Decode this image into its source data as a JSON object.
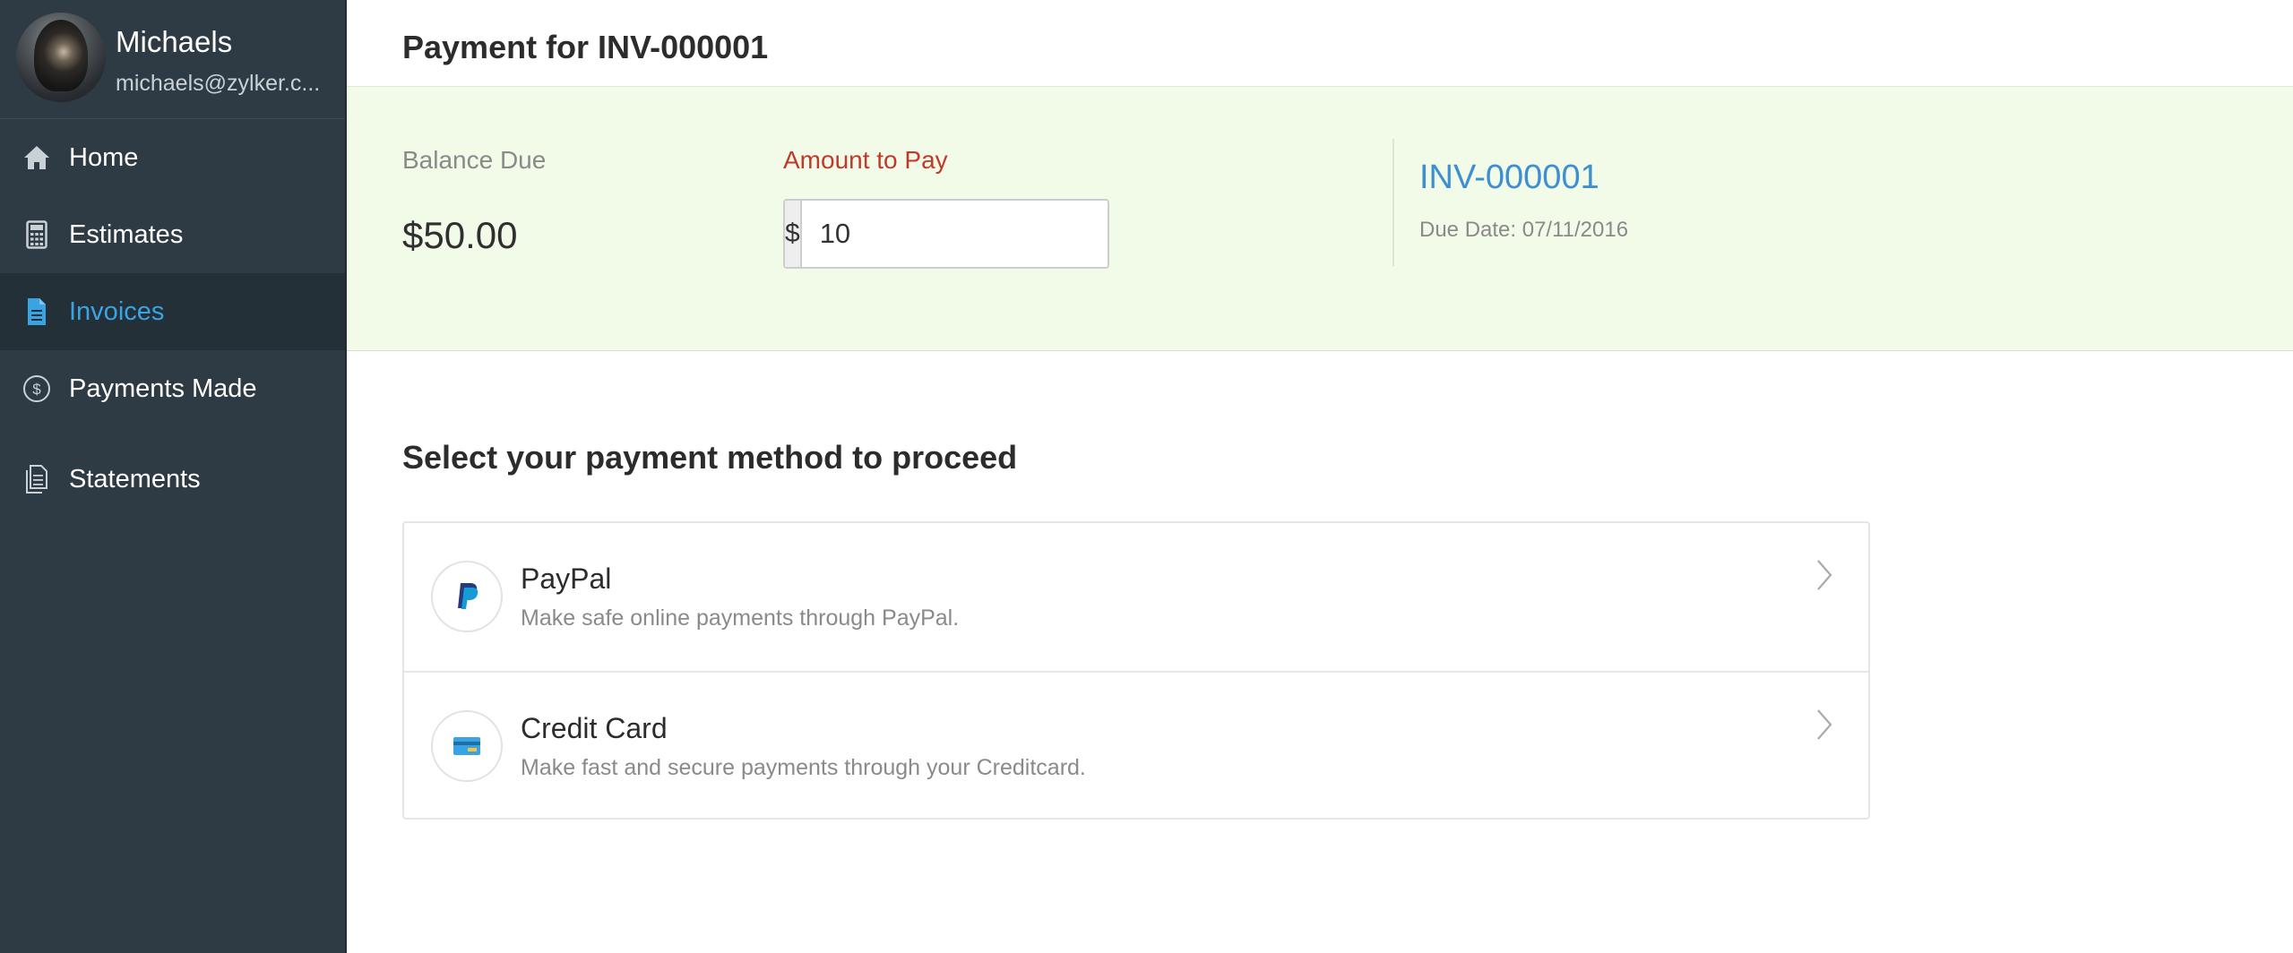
{
  "sidebar": {
    "profile": {
      "name": "Michaels",
      "email": "michaels@zylker.c..."
    },
    "items": [
      {
        "label": "Home",
        "icon": "home-icon",
        "active": false
      },
      {
        "label": "Estimates",
        "icon": "calculator-icon",
        "active": false
      },
      {
        "label": "Invoices",
        "icon": "document-icon",
        "active": true
      },
      {
        "label": "Payments Made",
        "icon": "dollar-circle-icon",
        "active": false
      },
      {
        "label": "Statements",
        "icon": "statements-icon",
        "active": false
      }
    ]
  },
  "main": {
    "title": "Payment for INV-000001",
    "summary": {
      "balance_label": "Balance Due",
      "balance_value": "$50.00",
      "amount_label": "Amount to Pay",
      "currency_symbol": "$",
      "amount_value": "10",
      "invoice_number": "INV-000001",
      "due_date": "Due Date: 07/11/2016"
    },
    "methods_heading": "Select your payment method to proceed",
    "methods": [
      {
        "title": "PayPal",
        "description": "Make safe online payments through PayPal.",
        "icon": "paypal-icon"
      },
      {
        "title": "Credit Card",
        "description": "Make fast and secure payments through your Creditcard.",
        "icon": "credit-card-icon"
      }
    ]
  },
  "colors": {
    "sidebar_bg": "#2e3b44",
    "sidebar_active_bg": "#243038",
    "accent_blue": "#3aa3e3",
    "amount_label_red": "#c0392b",
    "summary_bg": "#f2fbe8"
  }
}
